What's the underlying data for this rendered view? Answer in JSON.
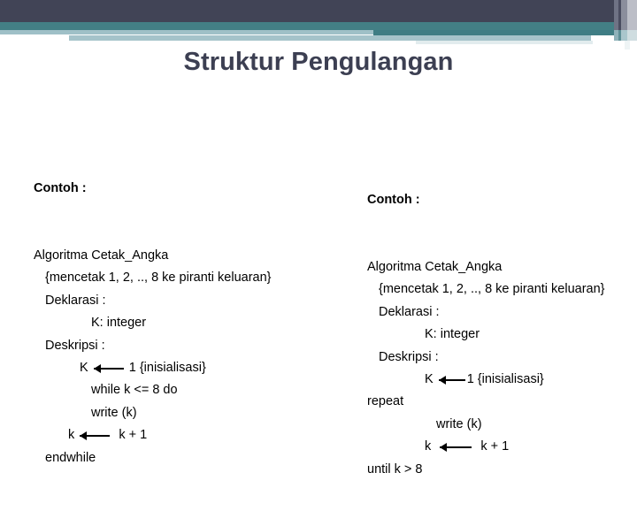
{
  "slide": {
    "title": "Struktur Pengulangan",
    "theme": {
      "title_color": "#3c3f52",
      "band_navy": "#414456",
      "band_teal": "#437f85",
      "band_light": "#9fc0c7",
      "text_color": "#000000",
      "background": "#ffffff"
    }
  },
  "left_example": {
    "heading": "Contoh :",
    "lines": [
      {
        "indent": 0,
        "before": "Algoritma Cetak_Angka",
        "arrow": false,
        "after": ""
      },
      {
        "indent": 1,
        "before": "{mencetak 1, 2, .., 8 ke piranti keluaran}",
        "arrow": false,
        "after": ""
      },
      {
        "indent": 1,
        "before": "Deklarasi :",
        "arrow": false,
        "after": ""
      },
      {
        "indent": 5,
        "before": "K: integer",
        "arrow": false,
        "after": ""
      },
      {
        "indent": 1,
        "before": "Deskripsi :",
        "arrow": false,
        "after": ""
      },
      {
        "indent": 4,
        "before": "K ",
        "arrow": true,
        "arrow_width": 34,
        "after": " 1 {inisialisasi}"
      },
      {
        "indent": 5,
        "before": "while k <= 8 do",
        "arrow": false,
        "after": ""
      },
      {
        "indent": 5,
        "before": "write (k)",
        "arrow": false,
        "after": ""
      },
      {
        "indent": 3,
        "before": "k ",
        "arrow": true,
        "arrow_width": 34,
        "after": "  k + 1"
      },
      {
        "indent": 1,
        "before": "endwhile",
        "arrow": false,
        "after": ""
      }
    ]
  },
  "right_example": {
    "heading": "Contoh :",
    "lines": [
      {
        "indent": 0,
        "before": "Algoritma Cetak_Angka",
        "arrow": false,
        "after": ""
      },
      {
        "indent": 1,
        "before": "{mencetak 1, 2, .., 8 ke piranti keluaran}",
        "arrow": false,
        "after": ""
      },
      {
        "indent": 1,
        "before": "Deklarasi :",
        "arrow": false,
        "after": ""
      },
      {
        "indent": 5,
        "before": "K: integer",
        "arrow": false,
        "after": ""
      },
      {
        "indent": 1,
        "before": "Deskripsi :",
        "arrow": false,
        "after": ""
      },
      {
        "indent": 5,
        "before": "K ",
        "arrow": true,
        "arrow_width": 30,
        "after": "1 {inisialisasi}"
      },
      {
        "indent": 0,
        "before": "repeat",
        "arrow": false,
        "after": ""
      },
      {
        "indent": 6,
        "before": "write (k)",
        "arrow": false,
        "after": ""
      },
      {
        "indent": 5,
        "before": "k  ",
        "arrow": true,
        "arrow_width": 36,
        "after": "  k + 1"
      },
      {
        "indent": 0,
        "before": "until k > 8",
        "arrow": false,
        "after": ""
      }
    ]
  }
}
